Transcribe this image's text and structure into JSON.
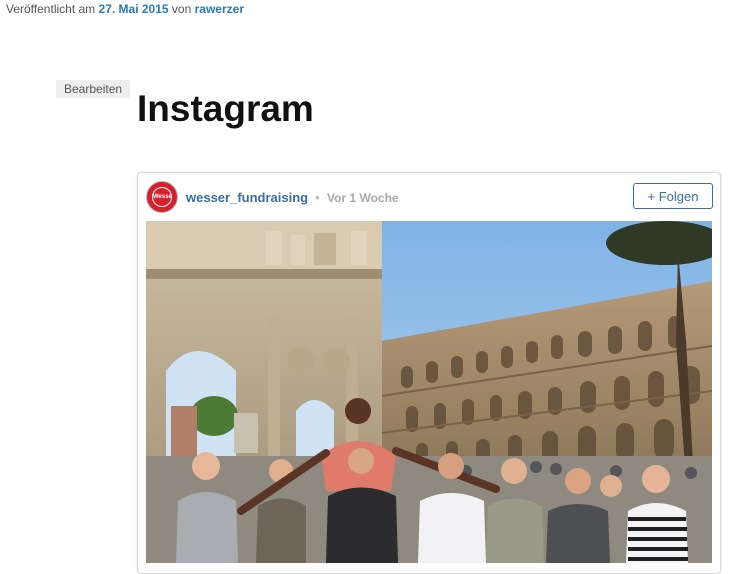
{
  "post_meta": {
    "prefix": "Veröffentlicht am",
    "date": "27. Mai 2015",
    "by": "von",
    "author": "rawerzer"
  },
  "edit_label": "Bearbeiten",
  "title": "Instagram",
  "instagram": {
    "avatar_icon": "wesser-logo-icon",
    "avatar_text": "Wesser",
    "username": "wesser_fundraising",
    "separator": "•",
    "time": "Vor 1 Woche",
    "follow_label": "+ Folgen",
    "accent": "#3a6ea5"
  }
}
